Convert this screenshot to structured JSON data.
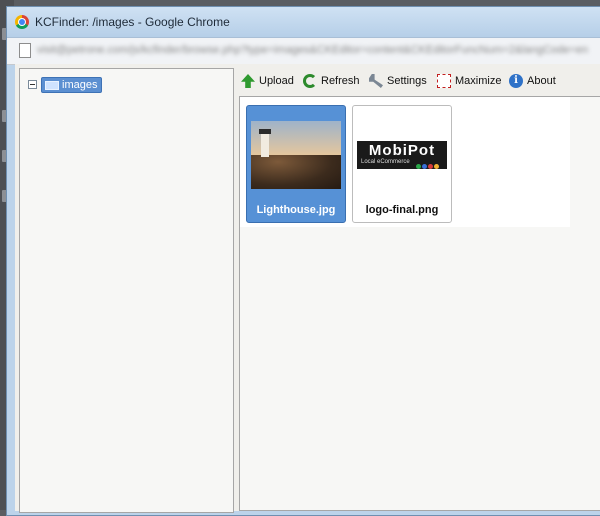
{
  "window": {
    "title": "KCFinder: /images - Google Chrome",
    "url": "visit@petrone.com/js/kcfinder/browse.php?type=images&CKEditor=content&CKEditorFuncNum=2&langCode=en"
  },
  "tree": {
    "root_label": "images"
  },
  "toolbar": {
    "upload_label": "Upload",
    "refresh_label": "Refresh",
    "settings_label": "Settings",
    "maximize_label": "Maximize",
    "about_label": "About",
    "about_icon_glyph": "i"
  },
  "files": [
    {
      "name": "Lighthouse.jpg",
      "selected": true
    },
    {
      "name": "logo-final.png",
      "selected": false
    }
  ],
  "logo_thumb": {
    "word": "MobiPot",
    "tagline": "Local eCommerce",
    "dot_colors": [
      "#2aa84a",
      "#3b6ed6",
      "#d63b3b",
      "#f2b233"
    ]
  }
}
